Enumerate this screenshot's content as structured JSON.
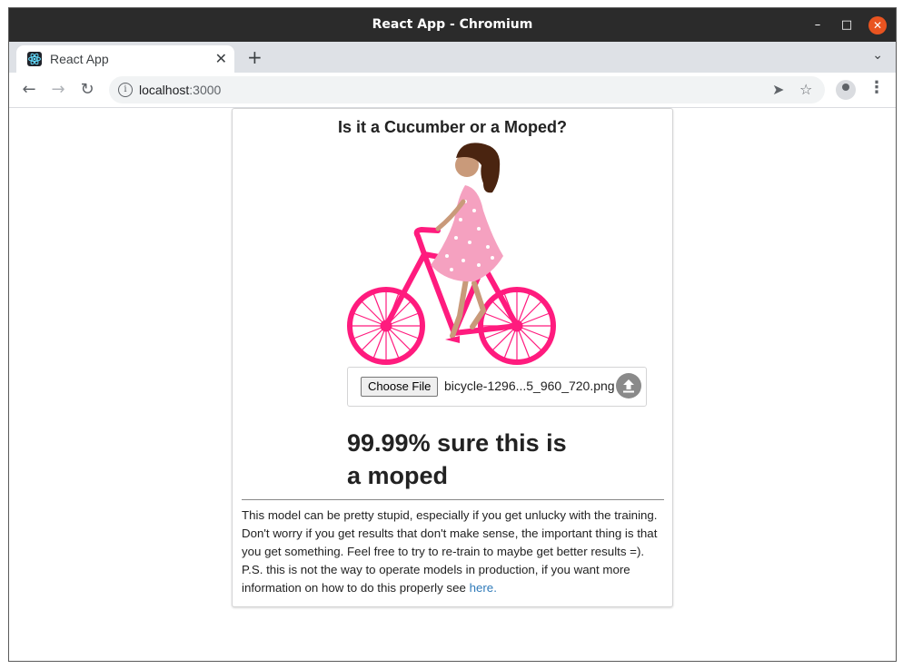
{
  "window": {
    "title": "React App - Chromium"
  },
  "tab": {
    "title": "React App"
  },
  "address": {
    "host": "localhost",
    "port": ":3000"
  },
  "page": {
    "heading": "Is it a Cucumber or a Moped?",
    "choose_file_label": "Choose File",
    "file_name": "bicycle-1296...5_960_720.png",
    "result": "99.99% sure this is a moped",
    "note": "This model can be pretty stupid, especially if you get unlucky with the training. Don't worry if you get results that don't make sense, the important thing is that you get something. Feel free to try to re-train to maybe get better results =). P.S. this is not the way to operate models in production, if you want more information on how to do this properly see",
    "link_text": "here."
  },
  "colors": {
    "bike": "#ff1b7e",
    "dress": "#f5a1c0",
    "hair": "#4a2410",
    "link": "#2f7ab9"
  },
  "icons": [
    "react-logo-icon",
    "tab-close-icon",
    "new-tab-icon",
    "back-icon",
    "forward-icon",
    "reload-icon",
    "info-icon",
    "send-icon",
    "star-icon",
    "profile-icon",
    "menu-icon",
    "upload-icon"
  ]
}
